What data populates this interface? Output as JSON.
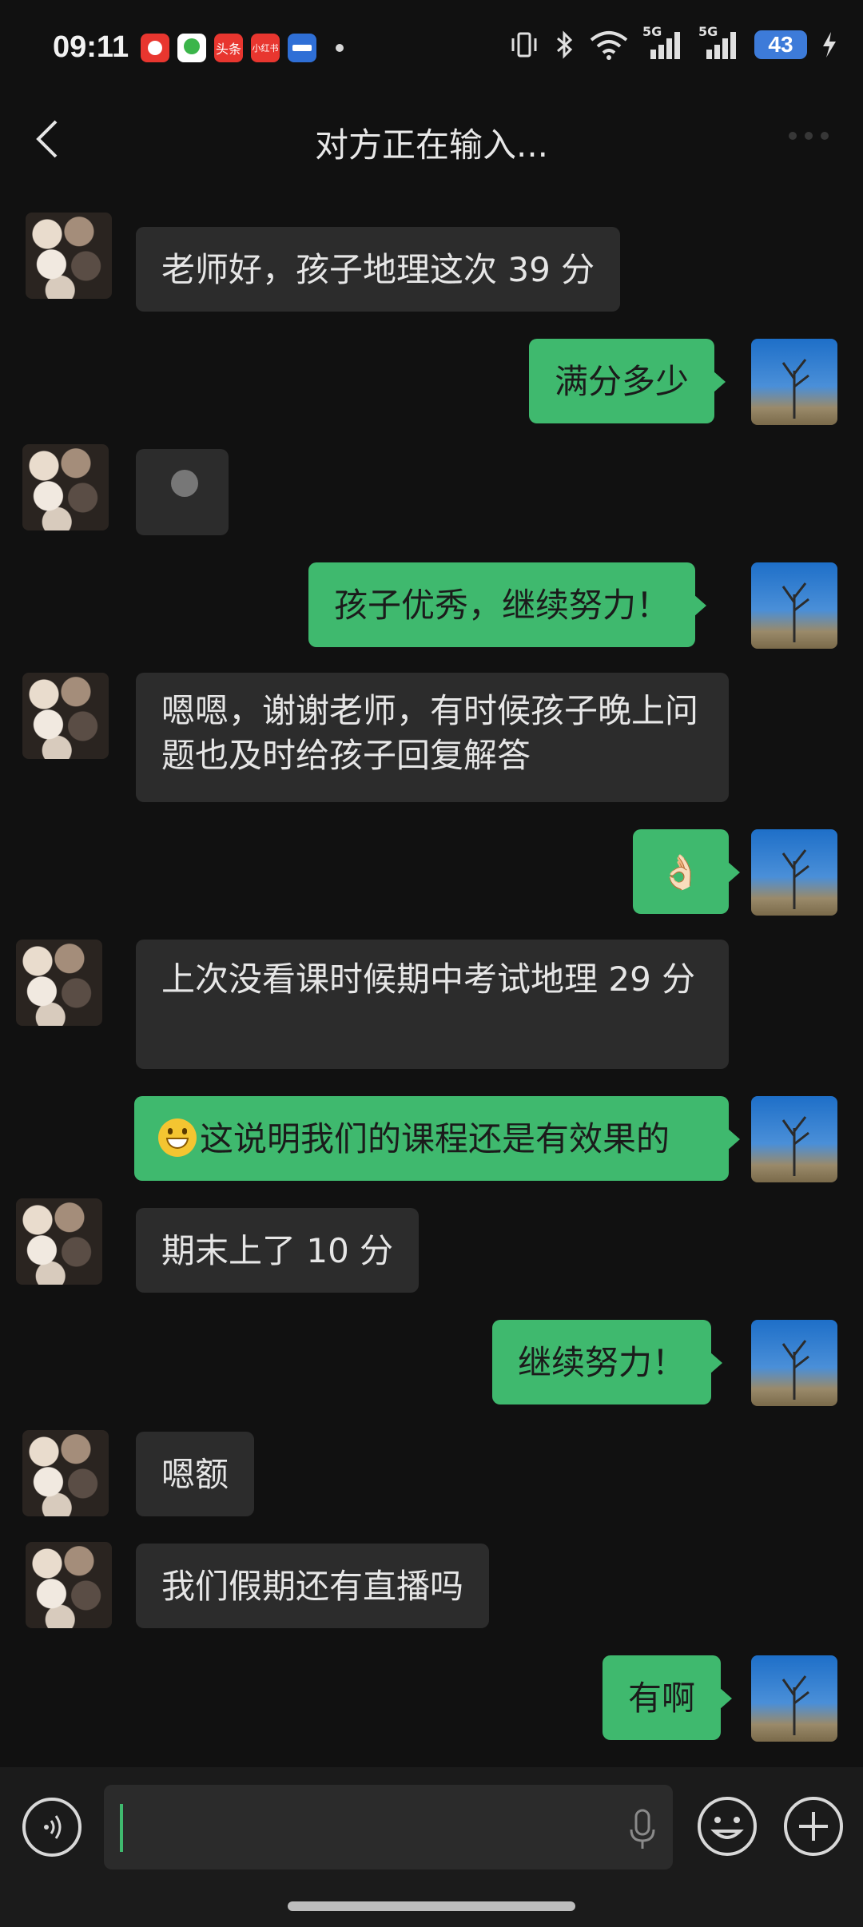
{
  "status_bar": {
    "time": "09:11",
    "app_icons": [
      {
        "name": "red-video-app-icon",
        "color": "#e8362f"
      },
      {
        "name": "green-video-app-icon",
        "color": "#3bb54a"
      },
      {
        "name": "toutiao-app-icon",
        "label": "头条",
        "color": "#e8362f"
      },
      {
        "name": "xiaohongshu-app-icon",
        "label": "小红书",
        "color": "#e8362f"
      },
      {
        "name": "blue-app-icon",
        "color": "#2f6fd6"
      }
    ],
    "signal_label_1": "5G",
    "signal_label_2": "5G",
    "battery": "43"
  },
  "header": {
    "title": "对方正在输入..."
  },
  "messages": [
    {
      "from": "peer",
      "text": "老师好，孩子地理这次 39 分"
    },
    {
      "from": "me",
      "text": "满分多少"
    },
    {
      "from": "peer",
      "text": ""
    },
    {
      "from": "me",
      "text": "孩子优秀，继续努力！"
    },
    {
      "from": "peer",
      "text": "嗯嗯，谢谢老师，有时候孩子晚上问题也及时给孩子回复解答"
    },
    {
      "from": "me",
      "text": "👌🏻"
    },
    {
      "from": "peer",
      "text": "上次没看课时候期中考试地理 29 分"
    },
    {
      "from": "me",
      "text": "这说明我们的课程还是有效果的"
    },
    {
      "from": "peer",
      "text": "期末上了 10 分"
    },
    {
      "from": "me",
      "text": "继续努力！"
    },
    {
      "from": "peer",
      "text": "嗯额"
    },
    {
      "from": "peer",
      "text": "我们假期还有直播吗"
    },
    {
      "from": "me",
      "text": "有啊"
    }
  ],
  "colors": {
    "background": "#111111",
    "my_bubble": "#3fb96e",
    "peer_bubble": "#2c2c2c",
    "cursor": "#3fb96e"
  }
}
